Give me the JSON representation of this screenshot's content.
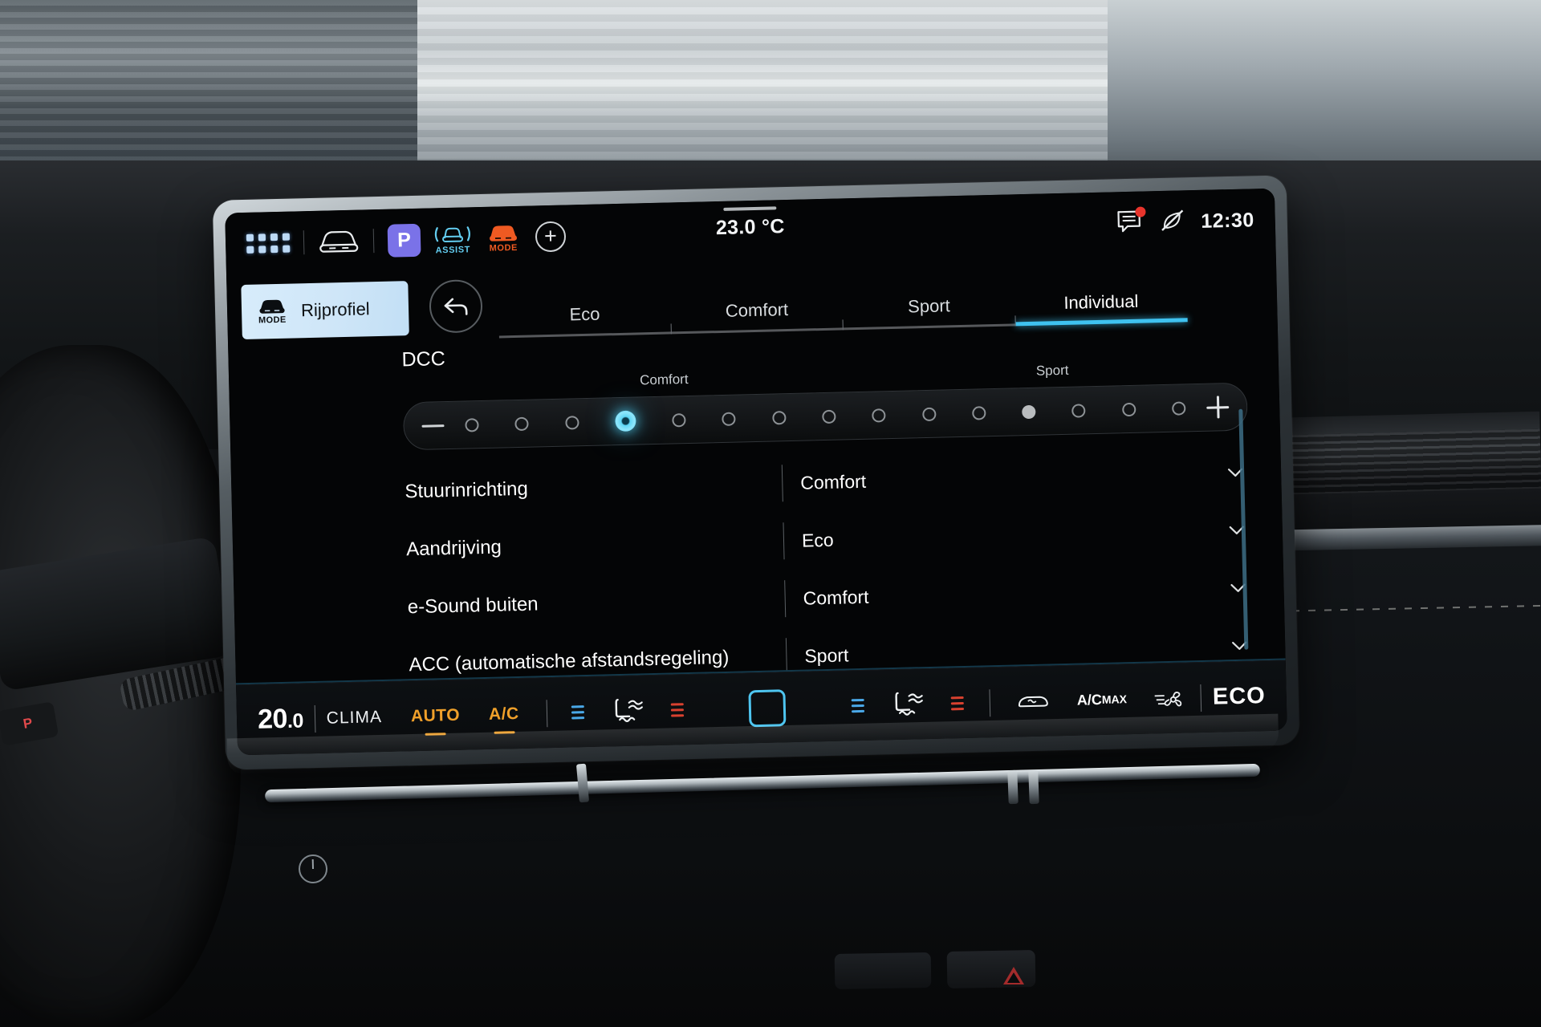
{
  "statusbar": {
    "apps_icon": "grid-apps-icon",
    "car_icon": "car-front-icon",
    "park_badge": "P",
    "assist_label": "ASSIST",
    "mode_label": "MODE",
    "add_icon": "plus-circle-icon",
    "temperature": "23.0 °C",
    "message_icon": "message-bubble-icon",
    "notification_dot": true,
    "eco_off_icon": "leaf-crossed-icon",
    "time": "12:30"
  },
  "app_tab": {
    "icon_label": "MODE",
    "label": "Rijprofiel"
  },
  "back_button": "back-arrow-icon",
  "tabs": [
    {
      "label": "Eco",
      "active": false
    },
    {
      "label": "Comfort",
      "active": false
    },
    {
      "label": "Sport",
      "active": false
    },
    {
      "label": "Individual",
      "active": true
    }
  ],
  "dcc": {
    "title": "DCC",
    "left_label": "Comfort",
    "right_label": "Sport",
    "minus_icon": "minus-icon",
    "plus_icon": "plus-icon",
    "steps": 15,
    "selected_index": 4,
    "marked_index": 11
  },
  "settings_rows": [
    {
      "name": "Stuurinrichting",
      "value": "Comfort",
      "chevron": "chevron-down-icon"
    },
    {
      "name": "Aandrijving",
      "value": "Eco",
      "chevron": "chevron-down-icon"
    },
    {
      "name": "e-Sound buiten",
      "value": "Comfort",
      "chevron": "chevron-down-icon"
    },
    {
      "name": "ACC (automatische afstandsregeling)",
      "value": "Sport",
      "chevron": "chevron-down-icon"
    }
  ],
  "climate": {
    "temperature": "20.0",
    "temp_int": "20",
    "temp_dec": ".0",
    "clima_label": "CLIMA",
    "auto_label": "AUTO",
    "ac_label": "A/C",
    "seat_left_icon": "seat-climate-icon",
    "seat_right_icon": "seat-climate-icon",
    "blower_icon": "blower-bars-icon",
    "center_button_icon": "square-button-icon",
    "rear_defrost_icon": "rear-defrost-icon",
    "ac_max_line1": "A/C",
    "ac_max_line2": "MAX",
    "fan_icon": "fan-icon",
    "eco_label": "ECO"
  },
  "vehicle": {
    "park_brake_label": "P"
  },
  "colors": {
    "accent_cyan": "#3fc2f0",
    "tab_highlight_bg": "#d0e7f8",
    "park_badge_bg": "#7a72e8",
    "mode_orange": "#ef5a22",
    "climate_orange": "#f0a02a",
    "notification_red": "#e8342c"
  }
}
